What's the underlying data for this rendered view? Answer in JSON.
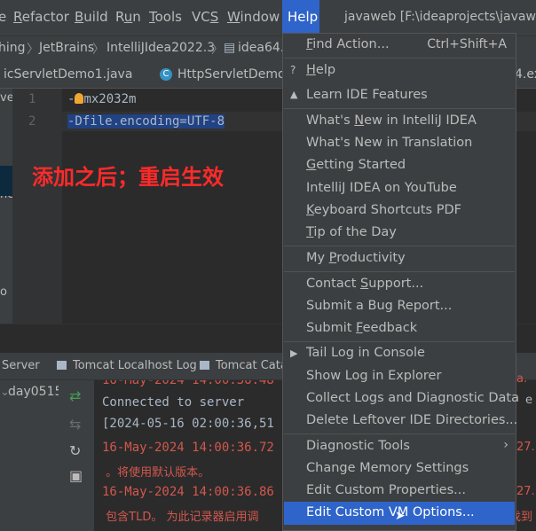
{
  "menubar": {
    "items": [
      {
        "pre": "e",
        "u": "",
        "post": ""
      },
      {
        "pre": "",
        "u": "R",
        "post": "efactor"
      },
      {
        "pre": "",
        "u": "B",
        "post": "uild"
      },
      {
        "pre": "R",
        "u": "u",
        "post": "n"
      },
      {
        "pre": "",
        "u": "T",
        "post": "ools"
      },
      {
        "pre": "VC",
        "u": "S",
        "post": ""
      },
      {
        "pre": "",
        "u": "W",
        "post": "indow"
      }
    ],
    "help": "Help",
    "title": "javaweb [F:\\ideaprojects\\javawe"
  },
  "breadcrumb": [
    "hing",
    "JetBrains",
    "IntelliJIdea2022.3",
    "idea64."
  ],
  "tabs": [
    "icServletDemo1.java",
    "HttpServletDemo",
    "4.ex"
  ],
  "editor": {
    "line_numbers": [
      "1",
      "2"
    ],
    "line1_pre": "-",
    "line1_post": "mx2032m",
    "line2": "-Dfile.encoding=UTF-8",
    "annotation": "添加之后；重启生效",
    "strip_labels": [
      "ve",
      "nc",
      "o"
    ]
  },
  "services": {
    "tabs": [
      "Server",
      "Tomcat Localhost Log",
      "Tomcat Catali"
    ],
    "tree_item": "day0515_",
    "console": [
      {
        "text": "16-May-2024 14:00:36.48",
        "color": "#d3574d"
      },
      {
        "text": "Connected to server",
        "color": "#a9b7c6"
      },
      {
        "text": "[2024-05-16 02:00:36,51",
        "color": "#a9b7c6"
      },
      {
        "text": "16-May-2024 14:00:36.72",
        "color": "#d3574d"
      },
      {
        "text": " 。将使用默认版本。",
        "color": "#d3574d"
      },
      {
        "text": "16-May-2024 14:00:36.86",
        "color": "#d3574d"
      },
      {
        "text": " 包含TLD。 为此记录器启用调",
        "color": "#d3574d"
      }
    ],
    "right_fragments": [
      "a.",
      "e",
      "27.",
      "27.",
      "找到"
    ]
  },
  "help_menu": {
    "items": [
      {
        "pre": "",
        "u": "F",
        "post": "ind Action...",
        "shortcut": "Ctrl+Shift+A"
      },
      {
        "pre": "",
        "u": "H",
        "post": "elp",
        "icon": "?"
      },
      {
        "pre": "Learn IDE Features",
        "u": "",
        "post": "",
        "icon": "grad"
      },
      {
        "pre": "What's ",
        "u": "N",
        "post": "ew in IntelliJ IDEA"
      },
      {
        "pre": "What's New in Translation",
        "u": "",
        "post": ""
      },
      {
        "pre": "",
        "u": "G",
        "post": "etting Started"
      },
      {
        "pre": "IntelliJ IDEA on YouTube",
        "u": "",
        "post": ""
      },
      {
        "pre": "",
        "u": "K",
        "post": "eyboard Shortcuts PDF"
      },
      {
        "pre": "",
        "u": "T",
        "post": "ip of the Day"
      },
      {
        "pre": "My ",
        "u": "P",
        "post": "roductivity"
      },
      {
        "pre": "Contact ",
        "u": "S",
        "post": "upport..."
      },
      {
        "pre": "Submit a Bug Report...",
        "u": "",
        "post": ""
      },
      {
        "pre": "Submit ",
        "u": "F",
        "post": "eedback"
      },
      {
        "pre": "Tail Log in Console",
        "u": "",
        "post": "",
        "icon": "play"
      },
      {
        "pre": "Show Log in Explorer",
        "u": "",
        "post": ""
      },
      {
        "pre": "Collect Logs and Diagnostic Data",
        "u": "",
        "post": ""
      },
      {
        "pre": "Delete Leftover IDE Directories...",
        "u": "",
        "post": ""
      },
      {
        "pre": "Diagnostic Tools",
        "u": "",
        "post": "",
        "submenu": true
      },
      {
        "pre": "Change Memory Settings",
        "u": "",
        "post": ""
      },
      {
        "pre": "Edit Custom Properties...",
        "u": "",
        "post": ""
      },
      {
        "pre": "Edit Custom VM Options...",
        "u": "",
        "post": ""
      }
    ]
  }
}
